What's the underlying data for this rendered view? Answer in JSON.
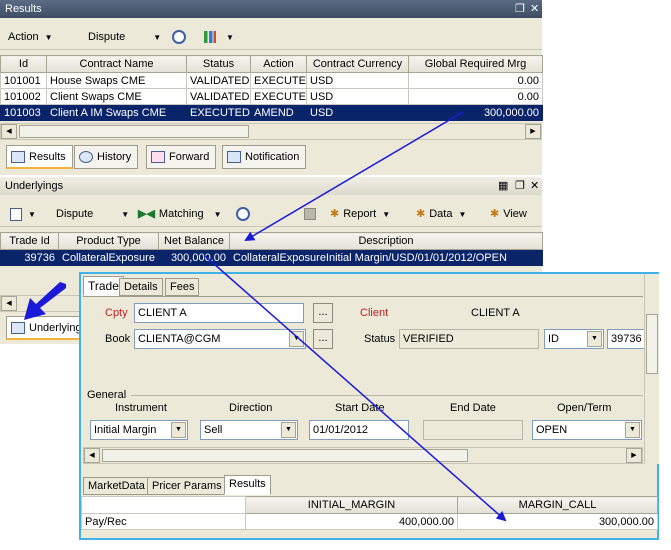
{
  "results": {
    "title": "Results",
    "toolbar": {
      "action": "Action",
      "dispute": "Dispute"
    },
    "columns": [
      "Id",
      "Contract Name",
      "Status",
      "Action",
      "Contract Currency",
      "Global Required Mrg"
    ],
    "rows": [
      [
        "101001",
        "House Swaps CME",
        "VALIDATED",
        "EXECUTE",
        "USD",
        "0.00"
      ],
      [
        "101002",
        "Client Swaps CME",
        "VALIDATED",
        "EXECUTE",
        "USD",
        "0.00"
      ],
      [
        "101003",
        "Client A IM Swaps CME",
        "EXECUTED",
        "AMEND",
        "USD",
        "300,000.00"
      ]
    ],
    "tabs": [
      "Results",
      "History",
      "Forward",
      "Notification"
    ]
  },
  "underlyings": {
    "title": "Underlyings",
    "toolbar": {
      "dispute": "Dispute",
      "matching": "Matching",
      "report": "Report",
      "data": "Data",
      "view": "View"
    },
    "columns": [
      "Trade Id",
      "Product Type",
      "Net Balance",
      "Description"
    ],
    "rows": [
      [
        "39736",
        "CollateralExposure",
        "300,000.00",
        "CollateralExposureInitial Margin/USD/01/01/2012/OPEN"
      ]
    ],
    "tab_label": "Underlying"
  },
  "trade": {
    "tabs": [
      "Trade",
      "Details",
      "Fees"
    ],
    "cpty_label": "Cpty",
    "cpty_value": "CLIENT A",
    "client_label": "Client",
    "client_value": "CLIENT A",
    "book_label": "Book",
    "book_value": "CLIENTA@CGM",
    "status_label": "Status",
    "status_value": "VERIFIED",
    "id_type": "ID",
    "id_value": "39736",
    "ellipsis": "...",
    "general_label": "General",
    "general_columns": [
      "Instrument",
      "Direction",
      "Start Date",
      "End Date",
      "Open/Term"
    ],
    "instrument": "Initial Margin",
    "direction": "Sell",
    "start_date": "01/01/2012",
    "end_date": "",
    "open_term": "OPEN",
    "bottom_tabs": [
      "MarketData",
      "Pricer Params",
      "Results"
    ],
    "result_columns": [
      "INITIAL_MARGIN",
      "MARGIN_CALL"
    ],
    "result_row_label": "Pay/Rec",
    "result_values": [
      "400,000.00",
      "300,000.00"
    ]
  },
  "colors": {
    "selection": "#0a246a",
    "arrow": "#1a1ad8",
    "popup_border": "#3fb3e8",
    "active_tab": "#f2b43c"
  }
}
